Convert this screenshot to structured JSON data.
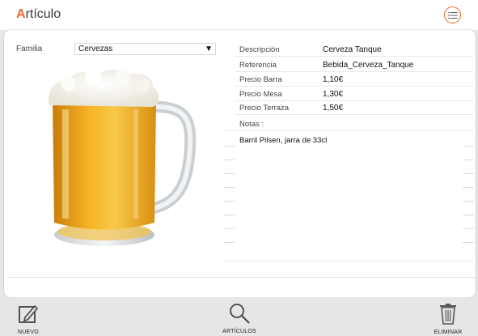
{
  "header": {
    "title_first": "A",
    "title_rest": "rtículo"
  },
  "form": {
    "familia_label": "Familia",
    "familia_value": "Cervezas",
    "dropdown_arrow": "▼",
    "fields": [
      {
        "label": "Descripción",
        "value": "Cerveza Tanque"
      },
      {
        "label": "Referencia",
        "value": "Bebida_Cerveza_Tanque"
      },
      {
        "label": "Precio Barra",
        "value": "1,10€"
      },
      {
        "label": "Precio Mesa",
        "value": "1,30€"
      },
      {
        "label": "Precio Terraza",
        "value": "1,50€"
      }
    ],
    "notes_label": "Notas :",
    "notes_value": "Barril Pilsen, jarra de 33cl"
  },
  "footer": {
    "nuevo": "NUEVO",
    "articulos": "ARTÍCULOS",
    "eliminar": "ELIMINAR"
  },
  "colors": {
    "accent": "#f26722"
  },
  "icons": {
    "menu": "list-icon",
    "nuevo": "edit-icon",
    "articulos": "search-icon",
    "eliminar": "trash-icon"
  }
}
